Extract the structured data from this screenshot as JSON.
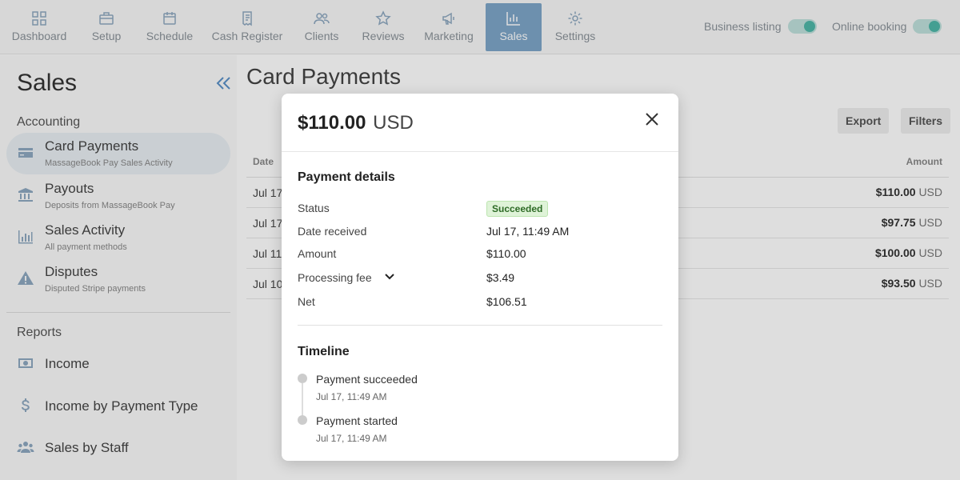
{
  "nav": {
    "items": [
      {
        "label": "Dashboard",
        "icon": "dashboard-icon"
      },
      {
        "label": "Setup",
        "icon": "briefcase-icon"
      },
      {
        "label": "Schedule",
        "icon": "calendar-icon"
      },
      {
        "label": "Cash Register",
        "icon": "receipt-icon"
      },
      {
        "label": "Clients",
        "icon": "people-icon"
      },
      {
        "label": "Reviews",
        "icon": "star-icon"
      },
      {
        "label": "Marketing",
        "icon": "megaphone-icon"
      },
      {
        "label": "Sales",
        "icon": "bar-chart-icon",
        "active": true
      },
      {
        "label": "Settings",
        "icon": "gear-icon"
      }
    ],
    "toggles": [
      {
        "label": "Business listing",
        "on": true
      },
      {
        "label": "Online booking",
        "on": true
      }
    ]
  },
  "sidebar": {
    "title": "Sales",
    "sections": [
      {
        "heading": "Accounting",
        "items": [
          {
            "label": "Card Payments",
            "sub": "MassageBook Pay Sales Activity",
            "icon": "credit-card-icon",
            "active": true
          },
          {
            "label": "Payouts",
            "sub": "Deposits from MassageBook Pay",
            "icon": "bank-icon"
          },
          {
            "label": "Sales Activity",
            "sub": "All payment methods",
            "icon": "bar-chart-icon"
          },
          {
            "label": "Disputes",
            "sub": "Disputed Stripe payments",
            "icon": "warning-icon"
          }
        ]
      },
      {
        "heading": "Reports",
        "items": [
          {
            "label": "Income",
            "icon": "cash-icon"
          },
          {
            "label": "Income by Payment Type",
            "icon": "dollar-icon"
          },
          {
            "label": "Sales by Staff",
            "icon": "group-icon"
          }
        ]
      }
    ]
  },
  "main": {
    "title": "Card Payments",
    "buttons": {
      "export": "Export",
      "filters": "Filters"
    },
    "table": {
      "columns": [
        "Date",
        "Amount"
      ],
      "rows": [
        {
          "date": "Jul 17",
          "amount": "$110.00",
          "currency": "USD"
        },
        {
          "date": "Jul 17",
          "amount": "$97.75",
          "currency": "USD"
        },
        {
          "date": "Jul 11",
          "amount": "$100.00",
          "currency": "USD"
        },
        {
          "date": "Jul 10",
          "amount": "$93.50",
          "currency": "USD"
        }
      ]
    }
  },
  "modal": {
    "amount": "$110.00",
    "currency": "USD",
    "details_heading": "Payment details",
    "details": {
      "status_label": "Status",
      "status_value": "Succeeded",
      "date_label": "Date received",
      "date_value": "Jul 17, 11:49 AM",
      "amount_label": "Amount",
      "amount_value": "$110.00",
      "fee_label": "Processing fee",
      "fee_value": "$3.49",
      "net_label": "Net",
      "net_value": "$106.51"
    },
    "timeline_heading": "Timeline",
    "timeline": [
      {
        "title": "Payment succeeded",
        "time": "Jul 17, 11:49 AM"
      },
      {
        "title": "Payment started",
        "time": "Jul 17, 11:49 AM"
      }
    ]
  },
  "colors": {
    "accent": "#7ea6c8",
    "toggle_on": "#4fb7a8",
    "success_bg": "#dff3d8",
    "success_text": "#2e6b26"
  }
}
